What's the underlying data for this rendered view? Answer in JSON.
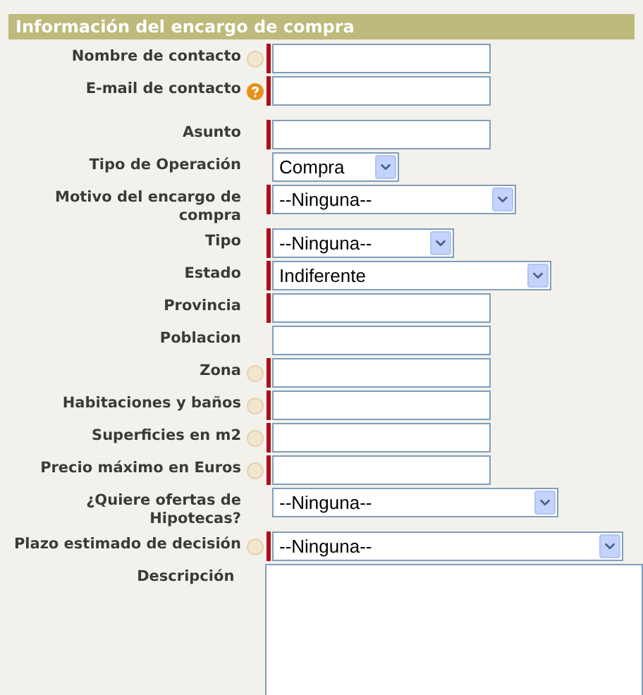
{
  "section_title": "Información del encargo de compra",
  "groups": [
    {
      "fields": [
        {
          "label": "Nombre de contacto",
          "kind": "text",
          "required": true,
          "hint": {
            "highlighted": false
          }
        },
        {
          "label": "E-mail de contacto",
          "kind": "text",
          "required": true,
          "hint": {
            "highlighted": true
          }
        }
      ]
    },
    {
      "fields": [
        {
          "label": "Asunto",
          "kind": "text",
          "required": true
        },
        {
          "label": "Tipo de Operación",
          "kind": "select",
          "required": false,
          "value": "Compra"
        },
        {
          "label": "Motivo del encargo de compra",
          "kind": "select",
          "required": true,
          "value": "--Ninguna--"
        },
        {
          "label": "Tipo",
          "kind": "select",
          "required": true,
          "value": "--Ninguna--"
        },
        {
          "label": "Estado",
          "kind": "select",
          "required": true,
          "value": "Indiferente"
        },
        {
          "label": "Provincia",
          "kind": "text",
          "required": true
        },
        {
          "label": "Poblacion",
          "kind": "text",
          "required": false
        },
        {
          "label": "Zona",
          "kind": "text",
          "required": true,
          "hint": {
            "highlighted": false
          }
        },
        {
          "label": "Habitaciones y baños",
          "kind": "text",
          "required": true,
          "hint": {
            "highlighted": false
          }
        },
        {
          "label": "Superficies en m2",
          "kind": "text",
          "required": true,
          "hint": {
            "highlighted": false
          }
        },
        {
          "label": "Precio máximo en Euros",
          "kind": "text",
          "required": true,
          "hint": {
            "highlighted": false
          }
        },
        {
          "label": "¿Quiere ofertas de Hipotecas?",
          "kind": "select",
          "required": false,
          "value": "--Ninguna--"
        },
        {
          "label": "Plazo estimado de decisión",
          "kind": "select",
          "required": true,
          "value": "--Ninguna--",
          "hint": {
            "highlighted": false
          }
        },
        {
          "label": "Descripción",
          "kind": "textarea",
          "required": false
        }
      ]
    }
  ]
}
